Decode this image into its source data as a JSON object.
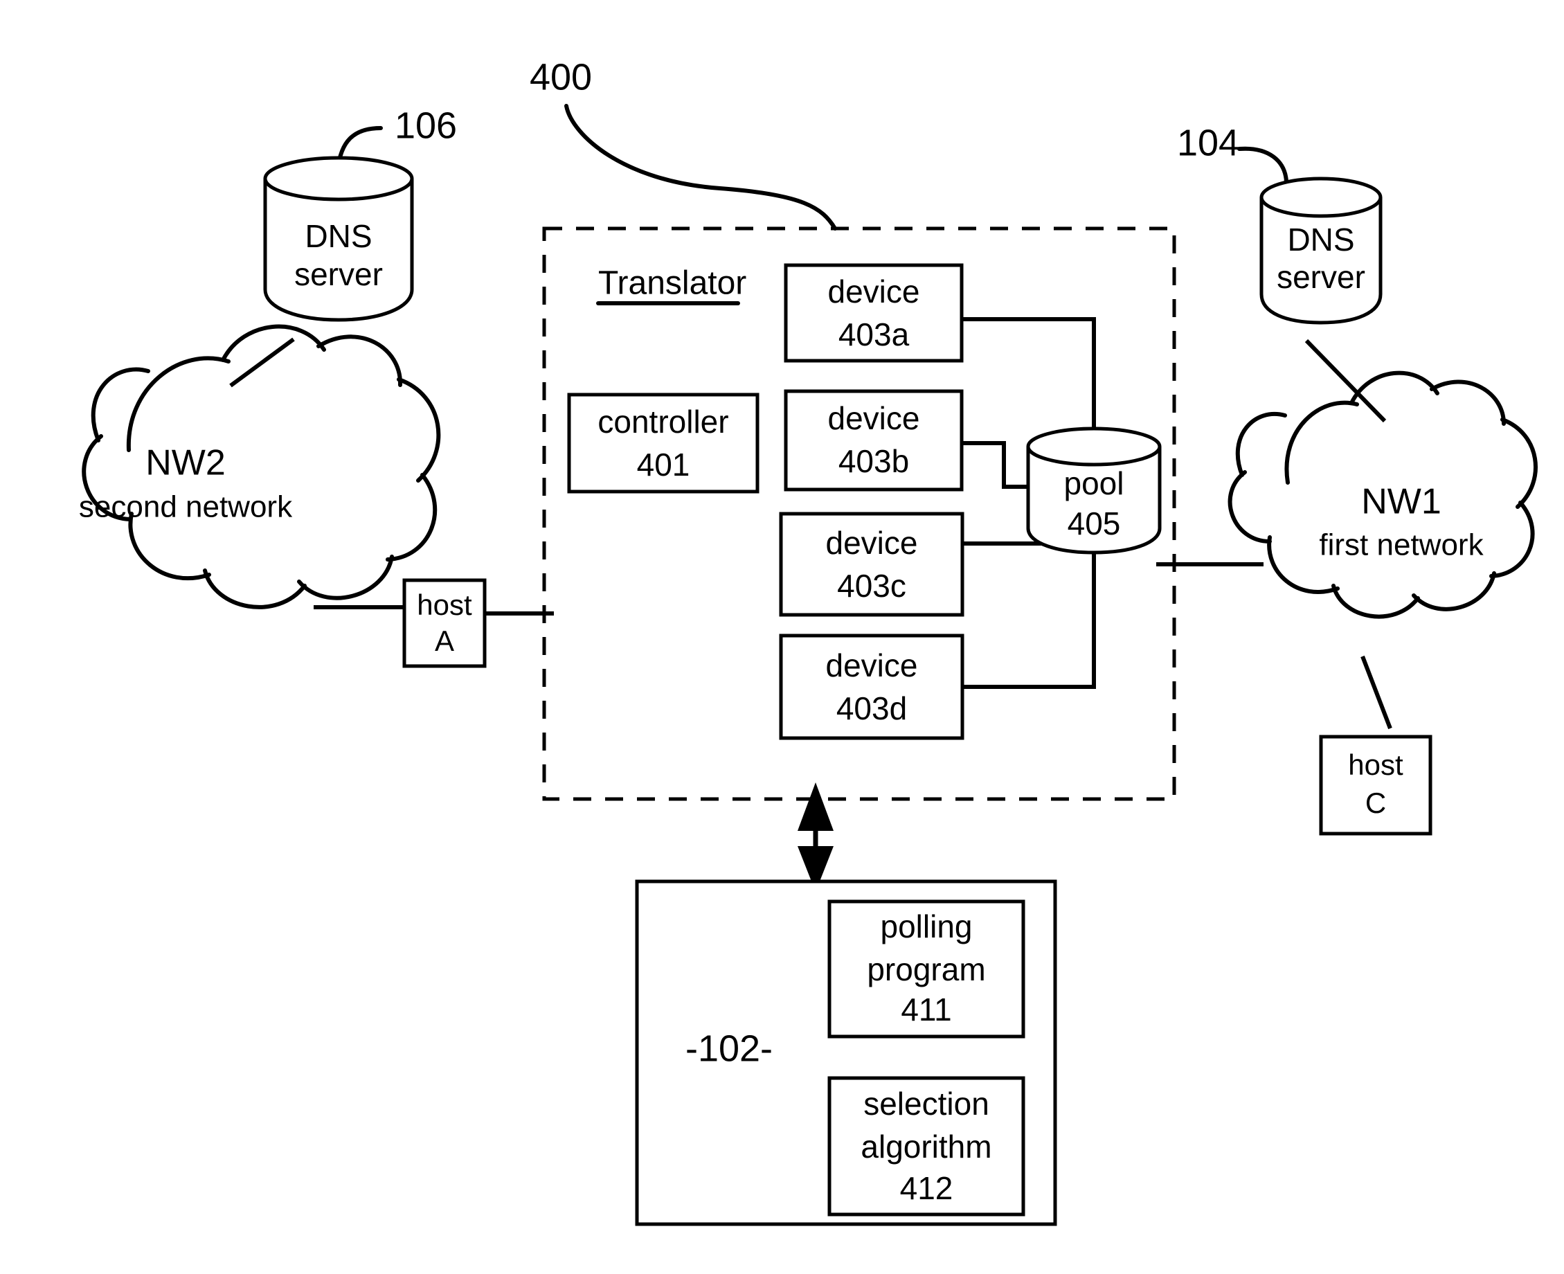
{
  "figure": {
    "title_ref": "400",
    "system_ref": "-102-"
  },
  "dns_left": {
    "line1": "DNS",
    "line2": "server",
    "ref": "106"
  },
  "dns_right": {
    "line1": "DNS",
    "line2": "server",
    "ref": "104"
  },
  "cloud_left": {
    "name": "NW2",
    "desc": "second network"
  },
  "cloud_right": {
    "name": "NW1",
    "desc": "first network"
  },
  "host_a": {
    "line1": "host",
    "line2": "A"
  },
  "host_c": {
    "line1": "host",
    "line2": "C"
  },
  "translator": {
    "title": "Translator",
    "controller": {
      "line1": "controller",
      "line2": "401"
    },
    "devices": [
      {
        "line1": "device",
        "line2": "403a"
      },
      {
        "line1": "device",
        "line2": "403b"
      },
      {
        "line1": "device",
        "line2": "403c"
      },
      {
        "line1": "device",
        "line2": "403d"
      }
    ],
    "pool": {
      "line1": "pool",
      "line2": "405"
    }
  },
  "system_box": {
    "ref": "-102-",
    "polling": {
      "line1": "polling",
      "line2": "program",
      "line3": "411"
    },
    "selection": {
      "line1": "selection",
      "line2": "algorithm",
      "line3": "412"
    }
  },
  "colors": {
    "ink": "#000000",
    "paper": "#ffffff"
  }
}
